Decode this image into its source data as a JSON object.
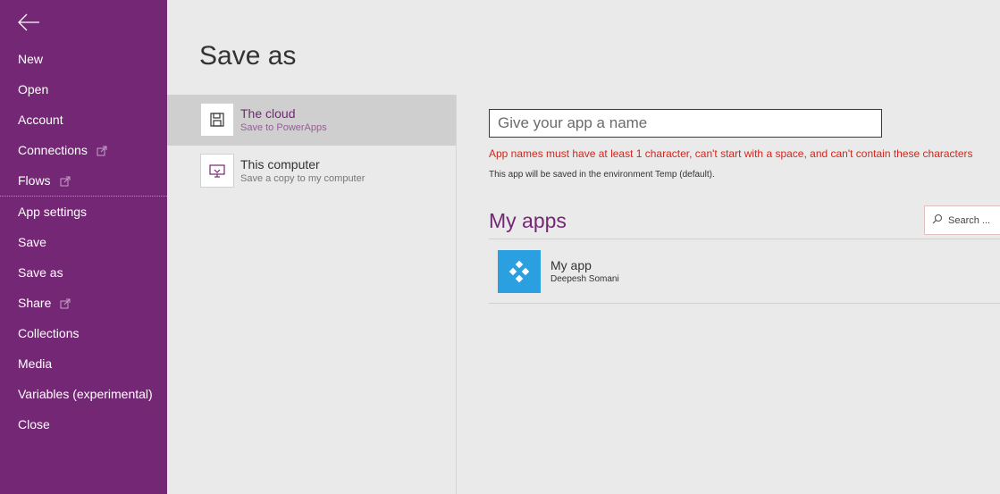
{
  "colors": {
    "nav_bg": "#742774",
    "accent": "#742774",
    "error": "#d0271d",
    "app_tile": "#2aa0e0"
  },
  "nav": {
    "back_icon": "arrow-left-icon",
    "items": [
      {
        "label": "New",
        "external": false
      },
      {
        "label": "Open",
        "external": false
      },
      {
        "label": "Account",
        "external": false
      },
      {
        "label": "Connections",
        "external": true
      },
      {
        "label": "Flows",
        "external": true
      },
      {
        "label": "App settings",
        "external": false
      },
      {
        "label": "Save",
        "external": false
      },
      {
        "label": "Save as",
        "external": false
      },
      {
        "label": "Share",
        "external": true
      },
      {
        "label": "Collections",
        "external": false
      },
      {
        "label": "Media",
        "external": false
      },
      {
        "label": "Variables (experimental)",
        "external": false
      },
      {
        "label": "Close",
        "external": false
      }
    ]
  },
  "page": {
    "title": "Save as"
  },
  "save_options": [
    {
      "title": "The cloud",
      "subtitle": "Save to PowerApps",
      "icon": "floppy-disk-icon",
      "selected": true
    },
    {
      "title": "This computer",
      "subtitle": "Save a copy to my computer",
      "icon": "computer-icon",
      "selected": false
    }
  ],
  "name_input": {
    "placeholder": "Give your app a name",
    "value": ""
  },
  "error_text": "App names must have at least 1 character, can't start with a space, and can't contain these characters",
  "env_text": "This app will be saved in the environment Temp (default).",
  "my_apps": {
    "heading": "My apps",
    "search_placeholder": "Search ...",
    "apps": [
      {
        "name": "My app",
        "owner": "Deepesh Somani",
        "icon": "powerapps-app-icon"
      }
    ]
  }
}
